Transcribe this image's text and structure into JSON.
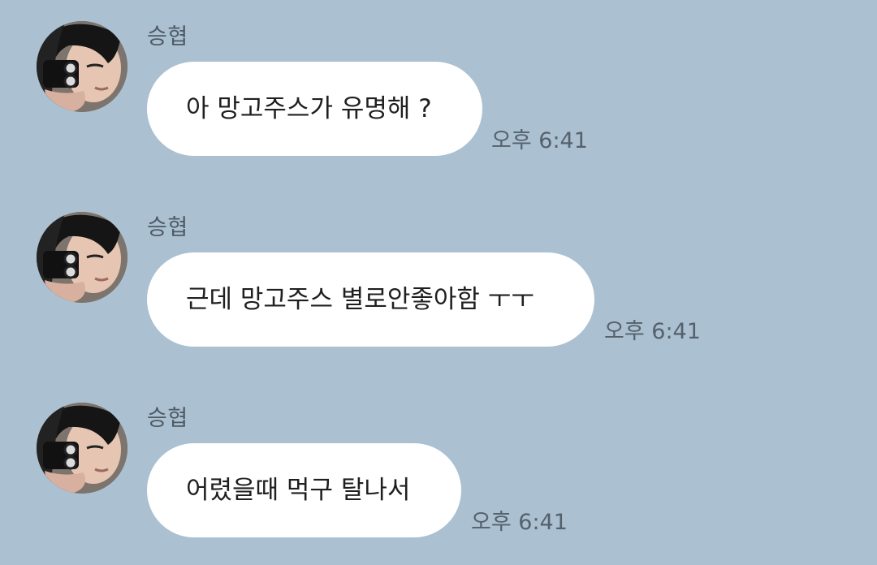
{
  "messages": [
    {
      "sender": "승협",
      "text": "아 망고주스가 유명해 ?",
      "time": "오후 6:41"
    },
    {
      "sender": "승협",
      "text": "근데 망고주스 별로안좋아함 ㅜㅜ",
      "time": "오후 6:41"
    },
    {
      "sender": "승협",
      "text": "어렸을때 먹구 탈나서",
      "time": "오후 6:41"
    }
  ]
}
